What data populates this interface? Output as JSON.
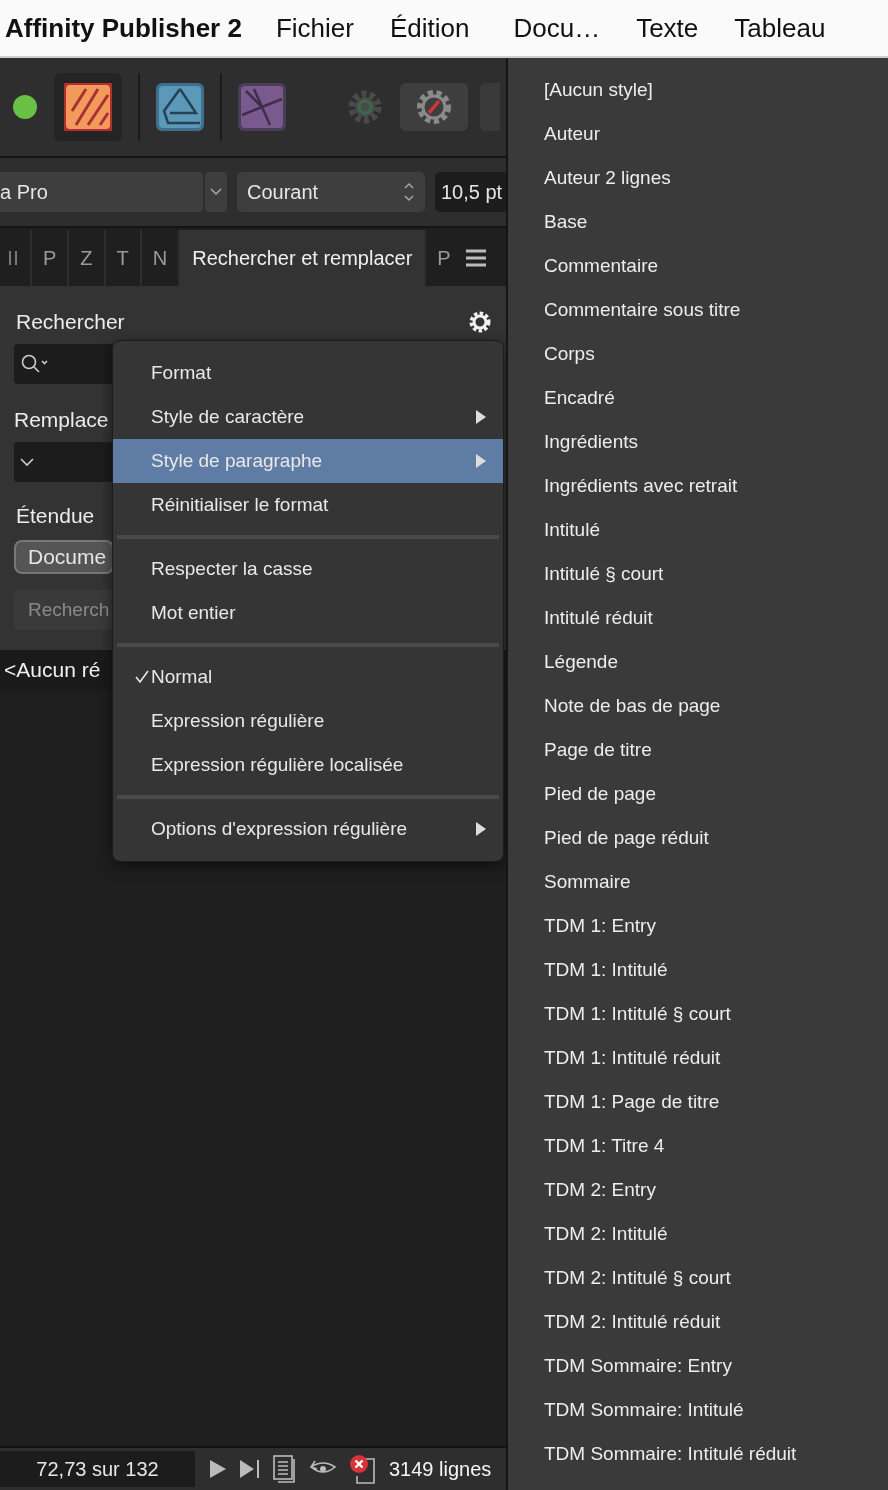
{
  "menu_bar": {
    "app_name": "Affinity Publisher 2",
    "items": [
      "Fichier",
      "Édition",
      "Docu…",
      "Texte",
      "Tableau"
    ]
  },
  "toolbar": {
    "font_field": "a Pro",
    "style_field": "Courant",
    "size_field": "10,5 pt"
  },
  "panel_tabs": [
    {
      "label": "P",
      "selected": false
    },
    {
      "label": "Z",
      "selected": false
    },
    {
      "label": "T",
      "selected": false
    },
    {
      "label": "N",
      "selected": false
    },
    {
      "label": "Rechercher et remplacer",
      "selected": true
    },
    {
      "label": "P",
      "selected": false
    }
  ],
  "find_panel": {
    "find_label": "Rechercher",
    "replace_label": "Remplace",
    "scope_label": "Étendue",
    "scope_value": "Docume",
    "find_button": "Recherch",
    "result": "<Aucun ré"
  },
  "context_menu": [
    {
      "kind": "item",
      "label": "Format",
      "selected": false,
      "checked": false,
      "submenu": false
    },
    {
      "kind": "item",
      "label": "Style de caractère",
      "selected": false,
      "checked": false,
      "submenu": true
    },
    {
      "kind": "item",
      "label": "Style de paragraphe",
      "selected": true,
      "checked": false,
      "submenu": true
    },
    {
      "kind": "item",
      "label": "Réinitialiser le format",
      "selected": false,
      "checked": false,
      "submenu": false
    },
    {
      "kind": "separator"
    },
    {
      "kind": "item",
      "label": "Respecter la casse",
      "selected": false,
      "checked": false,
      "submenu": false
    },
    {
      "kind": "item",
      "label": "Mot entier",
      "selected": false,
      "checked": false,
      "submenu": false
    },
    {
      "kind": "separator"
    },
    {
      "kind": "item",
      "label": "Normal",
      "selected": false,
      "checked": true,
      "submenu": false
    },
    {
      "kind": "item",
      "label": "Expression régulière",
      "selected": false,
      "checked": false,
      "submenu": false
    },
    {
      "kind": "item",
      "label": "Expression régulière localisée",
      "selected": false,
      "checked": false,
      "submenu": false
    },
    {
      "kind": "separator"
    },
    {
      "kind": "item",
      "label": "Options d'expression régulière",
      "selected": false,
      "checked": false,
      "submenu": true
    }
  ],
  "paragraph_styles": [
    "[Aucun style]",
    "Auteur",
    "Auteur 2 lignes",
    "Base",
    "Commentaire",
    "Commentaire sous titre",
    "Corps",
    "Encadré",
    "Ingrédients",
    "Ingrédients avec retrait",
    "Intitulé",
    "Intitulé § court",
    "Intitulé réduit",
    "Légende",
    "Note de bas de page",
    "Page de titre",
    "Pied de page",
    "Pied de page réduit",
    "Sommaire",
    "TDM 1: Entry",
    "TDM 1: Intitulé",
    "TDM 1: Intitulé § court",
    "TDM 1: Intitulé réduit",
    "TDM 1: Page de titre",
    "TDM 1: Titre 4",
    "TDM 2: Entry",
    "TDM 2: Intitulé",
    "TDM 2: Intitulé § court",
    "TDM 2: Intitulé réduit",
    "TDM Sommaire: Entry",
    "TDM Sommaire: Intitulé",
    "TDM Sommaire: Intitulé réduit"
  ],
  "status_bar": {
    "position": "72,73 sur 132",
    "lines": "3149 lignes"
  }
}
